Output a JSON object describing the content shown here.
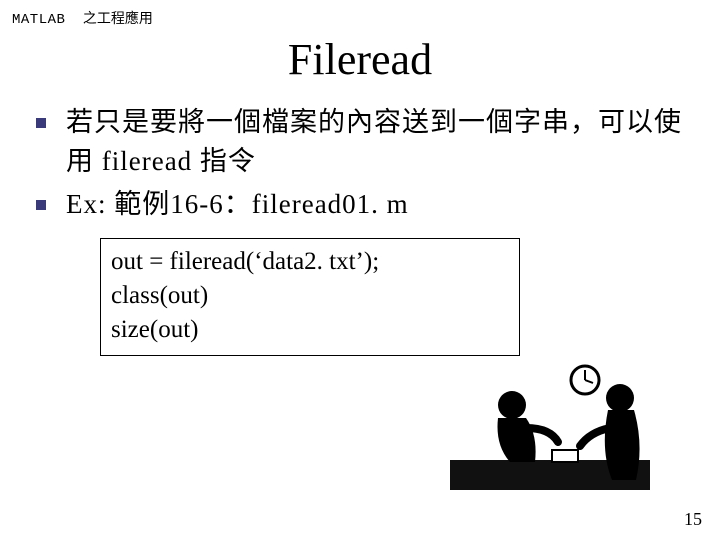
{
  "header": {
    "label": "MATLAB",
    "sub": "之工程應用"
  },
  "title": "Fileread",
  "bullets": [
    "若只是要將一個檔案的內容送到一個字串，可以使用 fileread 指令",
    "Ex: 範例16-6：fileread01. m"
  ],
  "code": {
    "lines": [
      "out = fileread(‘data2. txt’);",
      "class(out)",
      "size(out)"
    ]
  },
  "page_number": "15"
}
